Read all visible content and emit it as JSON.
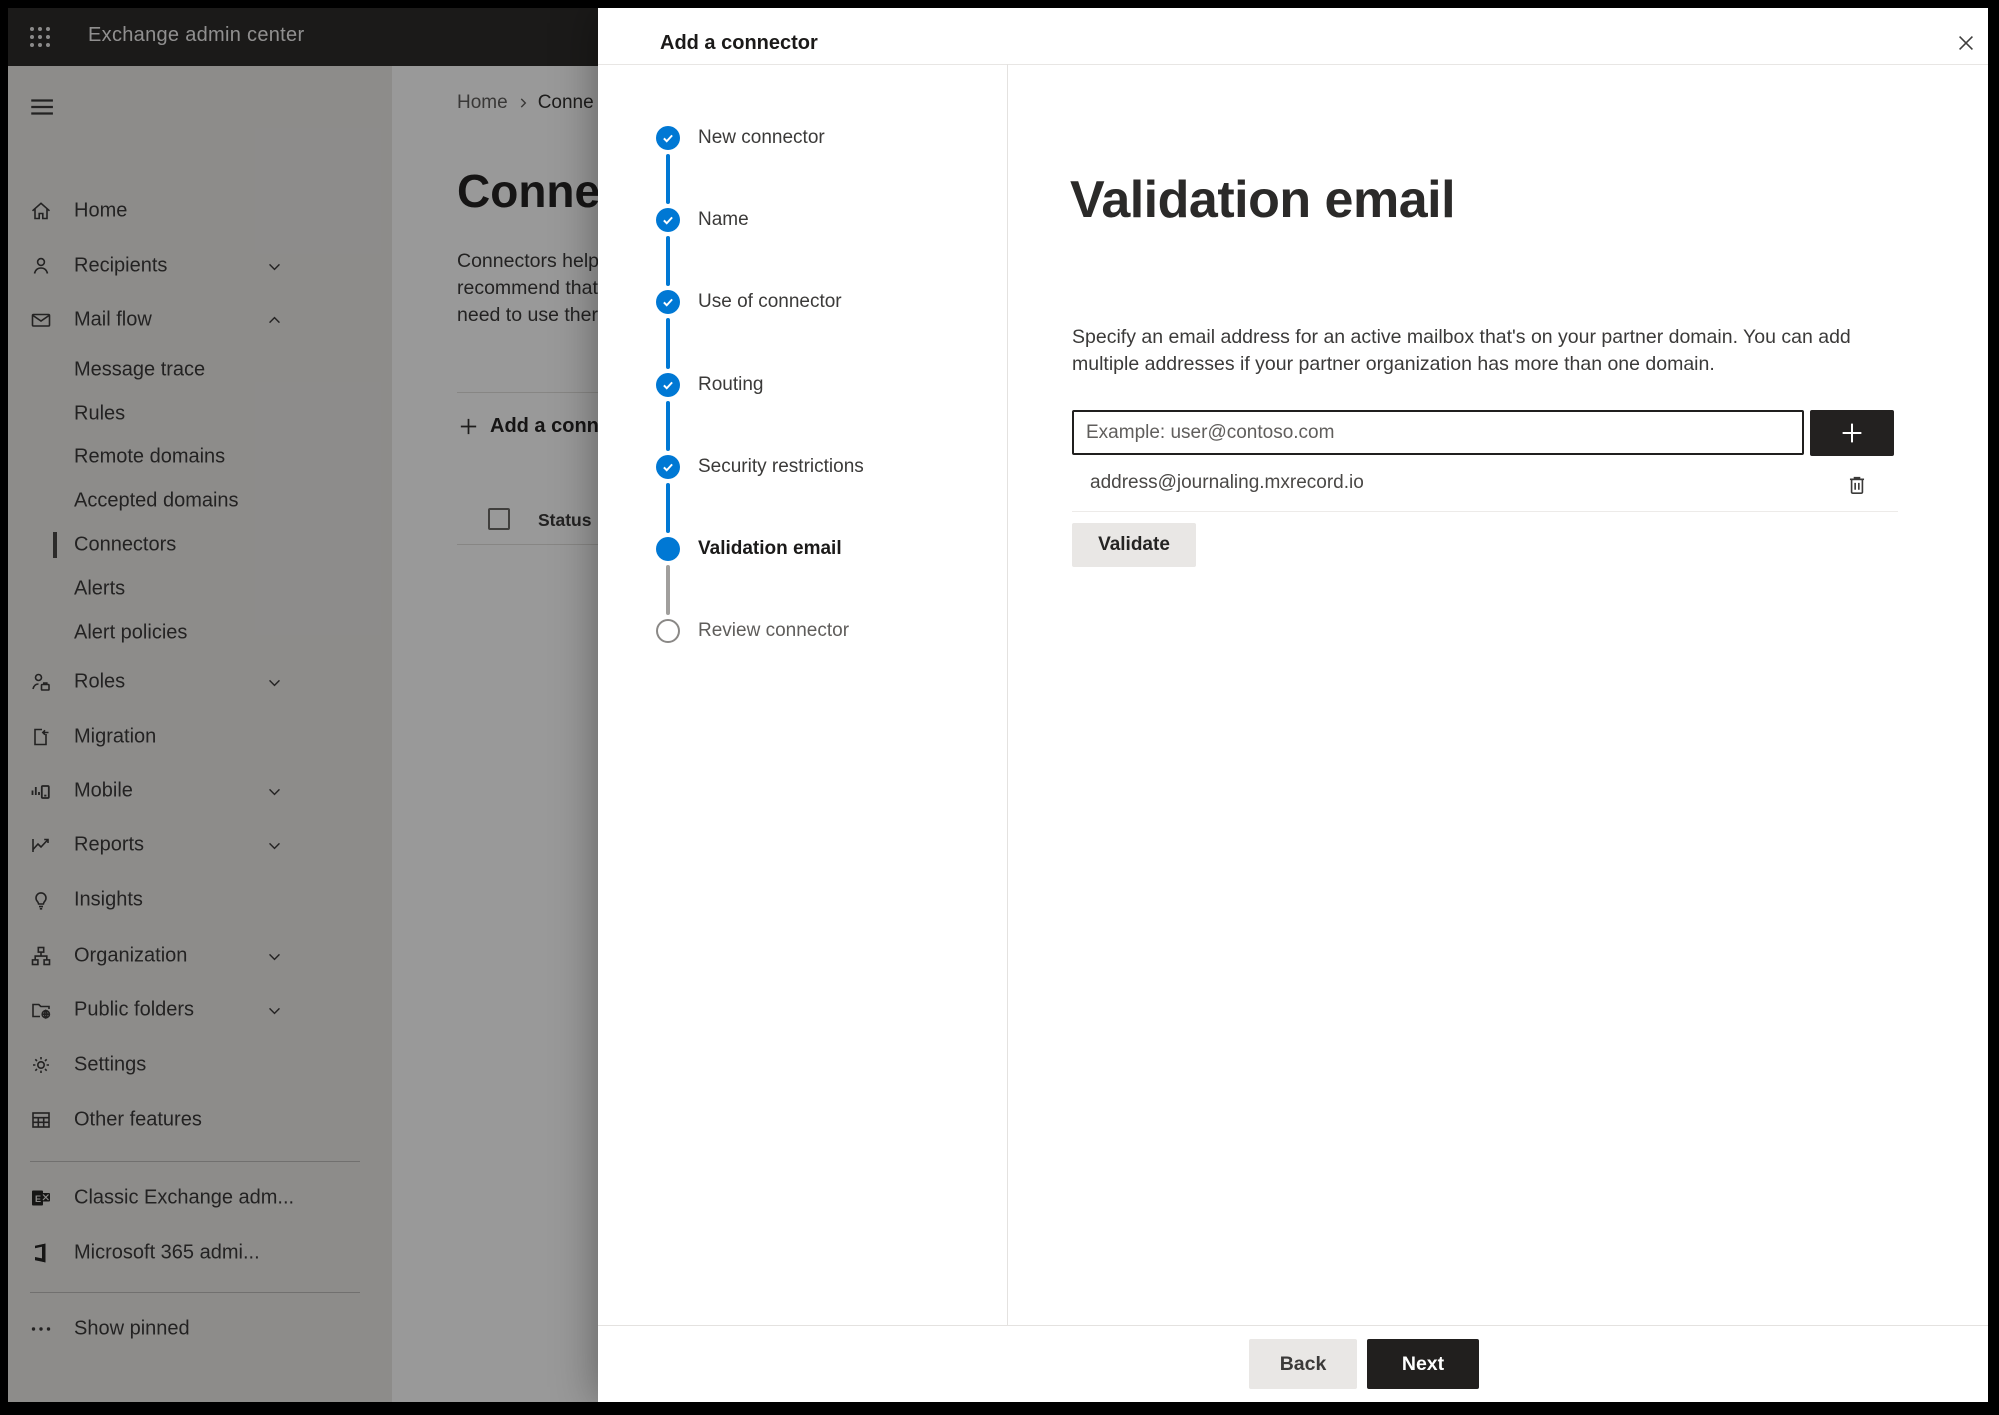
{
  "header": {
    "app_title": "Exchange admin center"
  },
  "sidebar": {
    "items": [
      {
        "label": "Home"
      },
      {
        "label": "Recipients",
        "chevron": "down"
      },
      {
        "label": "Mail flow",
        "chevron": "up"
      },
      {
        "label": "Message trace"
      },
      {
        "label": "Rules"
      },
      {
        "label": "Remote domains"
      },
      {
        "label": "Accepted domains"
      },
      {
        "label": "Connectors",
        "selected": true
      },
      {
        "label": "Alerts"
      },
      {
        "label": "Alert policies"
      },
      {
        "label": "Roles",
        "chevron": "down"
      },
      {
        "label": "Migration"
      },
      {
        "label": "Mobile",
        "chevron": "down"
      },
      {
        "label": "Reports",
        "chevron": "down"
      },
      {
        "label": "Insights"
      },
      {
        "label": "Organization",
        "chevron": "down"
      },
      {
        "label": "Public folders",
        "chevron": "down"
      },
      {
        "label": "Settings"
      },
      {
        "label": "Other features"
      },
      {
        "label": "Classic Exchange adm..."
      },
      {
        "label": "Microsoft 365 admi..."
      },
      {
        "label": "Show pinned"
      }
    ]
  },
  "page": {
    "breadcrumb": [
      "Home",
      "Conne"
    ],
    "title": "Connec",
    "description_lines": [
      "Connectors help",
      "recommend that",
      "need to use ther"
    ],
    "add_button_label": "Add a conn",
    "table": {
      "status_column": "Status"
    }
  },
  "wizard": {
    "title": "Add a connector",
    "steps": [
      {
        "label": "New connector",
        "state": "done"
      },
      {
        "label": "Name",
        "state": "done"
      },
      {
        "label": "Use of connector",
        "state": "done"
      },
      {
        "label": "Routing",
        "state": "done"
      },
      {
        "label": "Security restrictions",
        "state": "done"
      },
      {
        "label": "Validation email",
        "state": "current"
      },
      {
        "label": "Review connector",
        "state": "todo"
      }
    ]
  },
  "panel": {
    "title": "Validation email",
    "description": "Specify an email address for an active mailbox that's on your partner domain. You can add multiple addresses if your partner organization has more than one domain.",
    "email_input": {
      "value": "",
      "placeholder": "Example: user@contoso.com"
    },
    "addresses": [
      "address@journaling.mxrecord.io"
    ],
    "validate_button_label": "Validate",
    "back_button_label": "Back",
    "next_button_label": "Next"
  },
  "colors": {
    "accent": "#0078d4",
    "header_bg": "#2d2c2b",
    "primary_button_bg": "#211f1e"
  }
}
